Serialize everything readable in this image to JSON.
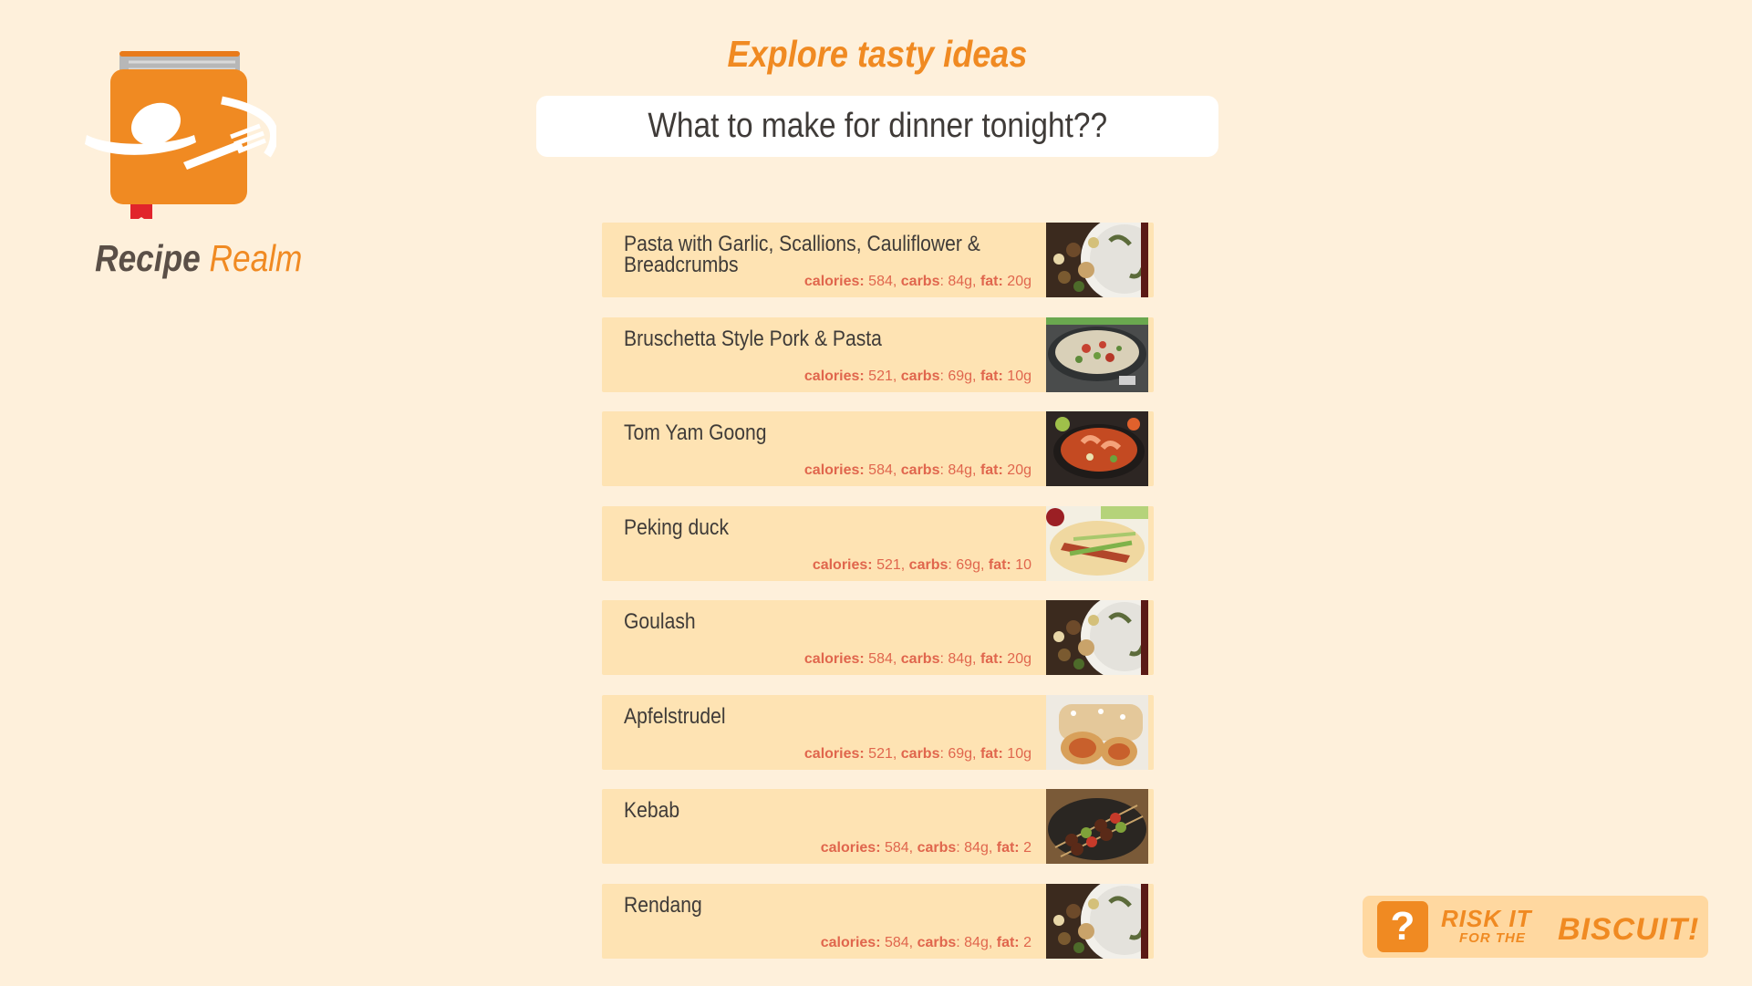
{
  "brand": {
    "word1": "Recipe",
    "word2": "Realm",
    "icon": "recipe-book-logo-icon",
    "colors": {
      "primary": "#f08a22",
      "dark": "#5a4f47"
    }
  },
  "header": {
    "title": "Explore tasty ideas",
    "prompt": "What to make for dinner tonight??"
  },
  "nutrition_labels": {
    "calories": "calories:",
    "carbs": "carbs",
    "fat": "fat:"
  },
  "recipes": [
    {
      "name": "Pasta with Garlic, Scallions, Cauliflower & Breadcrumbs",
      "calories": "584,",
      "carbs": ": 84g,",
      "fat": "20g",
      "image": "pasta-dish"
    },
    {
      "name": "Bruschetta Style Pork & Pasta",
      "calories": "521,",
      "carbs": ": 69g,",
      "fat": "10g",
      "image": "pork-pasta-pan"
    },
    {
      "name": "Tom Yam Goong",
      "calories": "584,",
      "carbs": ": 84g,",
      "fat": "20g",
      "image": "soup-bowl"
    },
    {
      "name": "Peking duck",
      "calories": "521,",
      "carbs": ": 69g,",
      "fat": "10",
      "image": "duck-wraps"
    },
    {
      "name": "Goulash",
      "calories": "584,",
      "carbs": ": 84g,",
      "fat": "20g",
      "image": "pasta-dish"
    },
    {
      "name": "Apfelstrudel",
      "calories": "521,",
      "carbs": ": 69g,",
      "fat": "10g",
      "image": "strudel"
    },
    {
      "name": "Kebab",
      "calories": "584,",
      "carbs": ": 84g,",
      "fat": "2",
      "image": "kebab-skewers"
    },
    {
      "name": "Rendang",
      "calories": "584,",
      "carbs": ": 84g,",
      "fat": "2",
      "image": "pasta-dish"
    }
  ],
  "risk_badge": {
    "icon": "question-mark-icon",
    "line1": "RISK IT",
    "line2": "FOR THE",
    "line3": "BISCUIT!"
  }
}
